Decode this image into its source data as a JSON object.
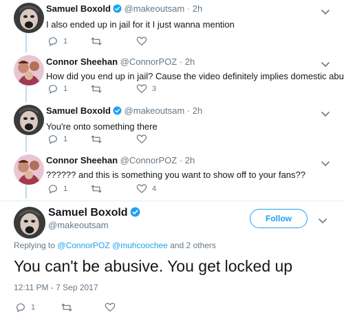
{
  "colors": {
    "accent": "#1da1f2",
    "text": "#14171a",
    "muted": "#657786",
    "thread_line": "#b8dcf5",
    "divider": "#e6ecf0"
  },
  "tweets": [
    {
      "name": "Samuel Boxold",
      "verified": true,
      "handle": "@makeoutsam",
      "dot": "·",
      "time": "2h",
      "text": "I also ended up in jail for it I just wanna mention",
      "reply_count": "1",
      "retweet_count": "",
      "like_count": ""
    },
    {
      "name": "Connor Sheehan",
      "verified": false,
      "handle": "@ConnorPOZ",
      "dot": "·",
      "time": "2h",
      "text": "How did you end up in jail? Cause the video definitely implies domestic abuse",
      "reply_count": "1",
      "retweet_count": "",
      "like_count": "3"
    },
    {
      "name": "Samuel Boxold",
      "verified": true,
      "handle": "@makeoutsam",
      "dot": "·",
      "time": "2h",
      "text": "You're onto something there",
      "reply_count": "1",
      "retweet_count": "",
      "like_count": ""
    },
    {
      "name": "Connor Sheehan",
      "verified": false,
      "handle": "@ConnorPOZ",
      "dot": "·",
      "time": "2h",
      "text": "?????? and this is something you want to show off to your fans??",
      "reply_count": "1",
      "retweet_count": "",
      "like_count": "4"
    }
  ],
  "main_tweet": {
    "name": "Samuel Boxold",
    "verified": true,
    "handle": "@makeoutsam",
    "follow_label": "Follow",
    "replying_prefix": "Replying to",
    "replying_user1": "@ConnorPOZ",
    "replying_user2": "@muhcoochee",
    "replying_suffix": "and 2 others",
    "text": "You can't be abusive. You get locked up",
    "timestamp": "12:11 PM - 7 Sep 2017",
    "reply_count": "1",
    "retweet_count": "",
    "like_count": ""
  },
  "icons": {
    "reply": "reply-icon",
    "retweet": "retweet-icon",
    "like": "heart-icon",
    "verified": "verified-badge-icon",
    "more": "chevron-down-icon"
  }
}
